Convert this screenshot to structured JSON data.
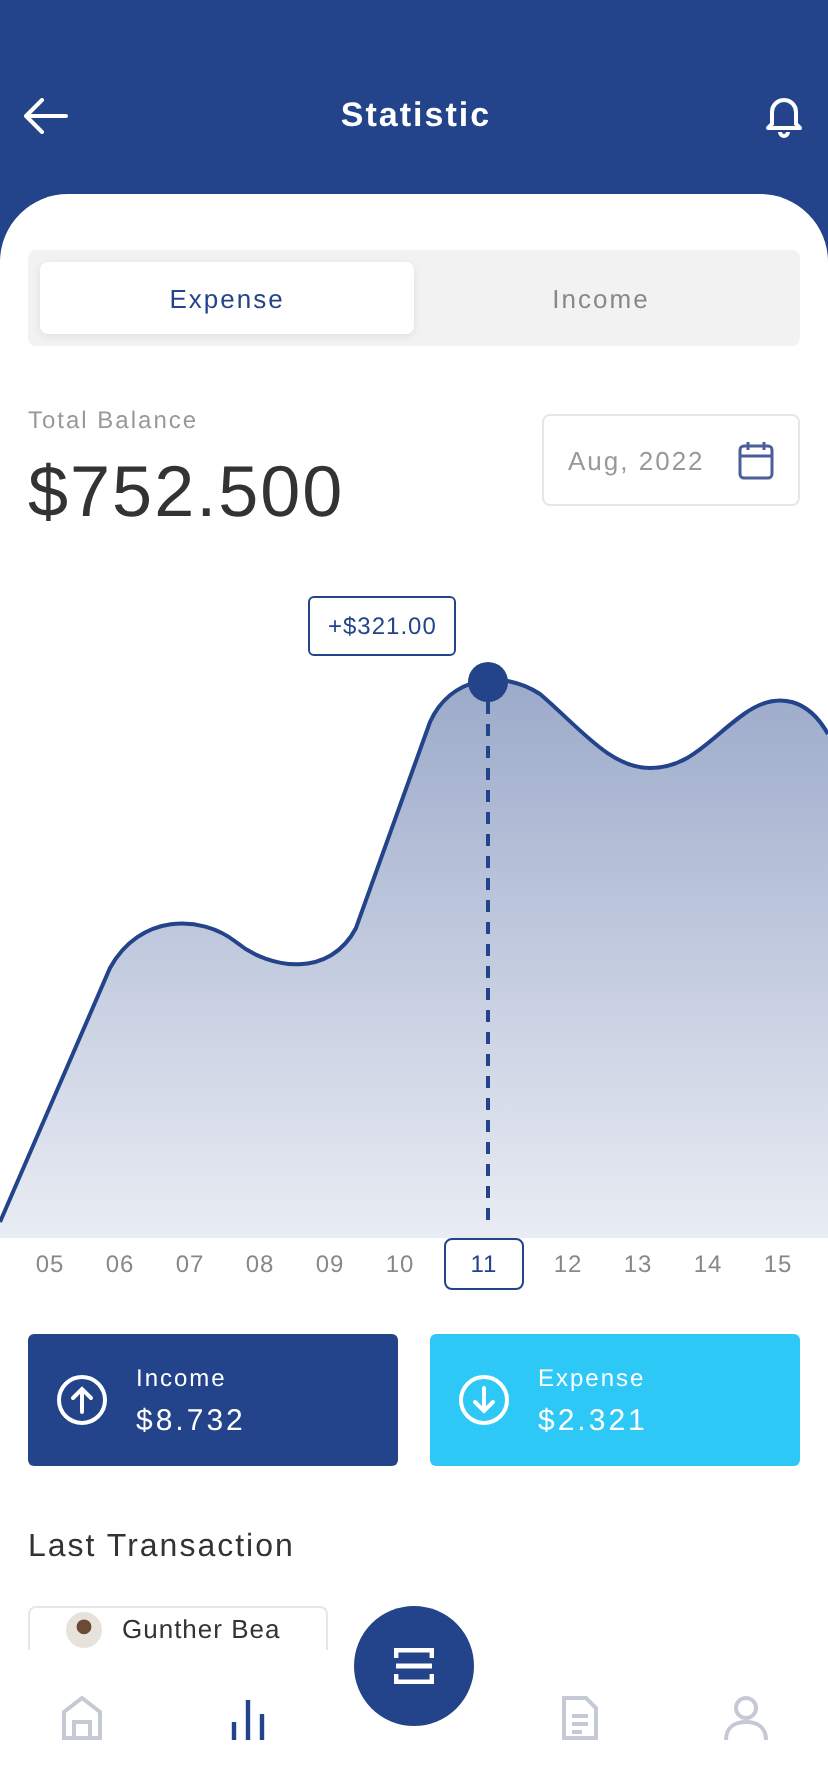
{
  "header": {
    "title": "Statistic"
  },
  "tabs": [
    {
      "label": "Expense",
      "selected": true
    },
    {
      "label": "Income",
      "selected": false
    }
  ],
  "balance": {
    "label": "Total Balance",
    "amount": "$752.500",
    "date": "Aug, 2022"
  },
  "chart": {
    "tooltip": "+$321.00",
    "days": [
      {
        "label": "05",
        "selected": false
      },
      {
        "label": "06",
        "selected": false
      },
      {
        "label": "07",
        "selected": false
      },
      {
        "label": "08",
        "selected": false
      },
      {
        "label": "09",
        "selected": false
      },
      {
        "label": "10",
        "selected": false
      },
      {
        "label": "11",
        "selected": true
      },
      {
        "label": "12",
        "selected": false
      },
      {
        "label": "13",
        "selected": false
      },
      {
        "label": "14",
        "selected": false
      },
      {
        "label": "15",
        "selected": false
      }
    ]
  },
  "summary": [
    {
      "kind": "income",
      "label": "Income",
      "amount": "$8.732",
      "color": "#23438a"
    },
    {
      "kind": "expense",
      "label": "Expense",
      "amount": "$2.321",
      "color": "#2ec8f7"
    }
  ],
  "transactions": {
    "title": "Last Transaction",
    "items": [
      {
        "name": "Gunther Bea"
      }
    ]
  },
  "nav": [
    {
      "kind": "home",
      "selected": false
    },
    {
      "kind": "stats",
      "selected": true
    },
    {
      "kind": "scan",
      "selected": false
    },
    {
      "kind": "document",
      "selected": false
    },
    {
      "kind": "profile",
      "selected": false
    }
  ]
}
